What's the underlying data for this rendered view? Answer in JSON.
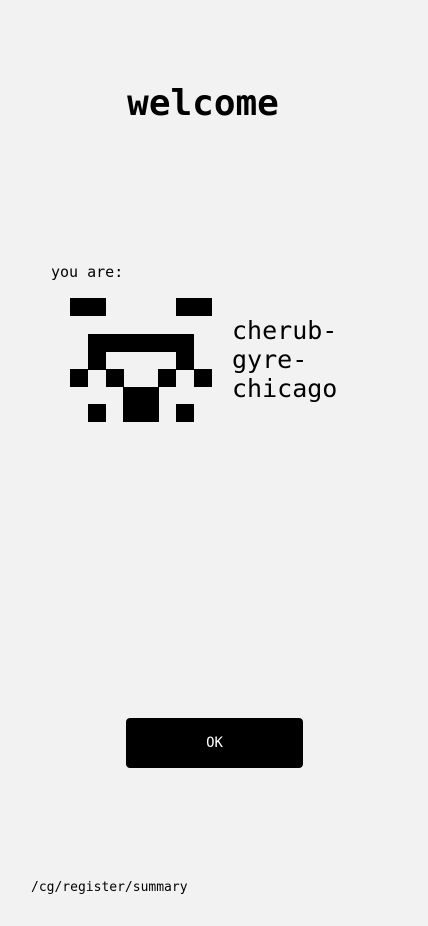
{
  "header": {
    "title": "welcome"
  },
  "identity": {
    "label": "you are:",
    "name_lines": [
      "cherub-",
      "gyre-",
      "chicago"
    ],
    "sigil_name": "pixel-sigil-icon"
  },
  "actions": {
    "ok_label": "OK"
  },
  "footer": {
    "path": "/cg/register/summary"
  }
}
